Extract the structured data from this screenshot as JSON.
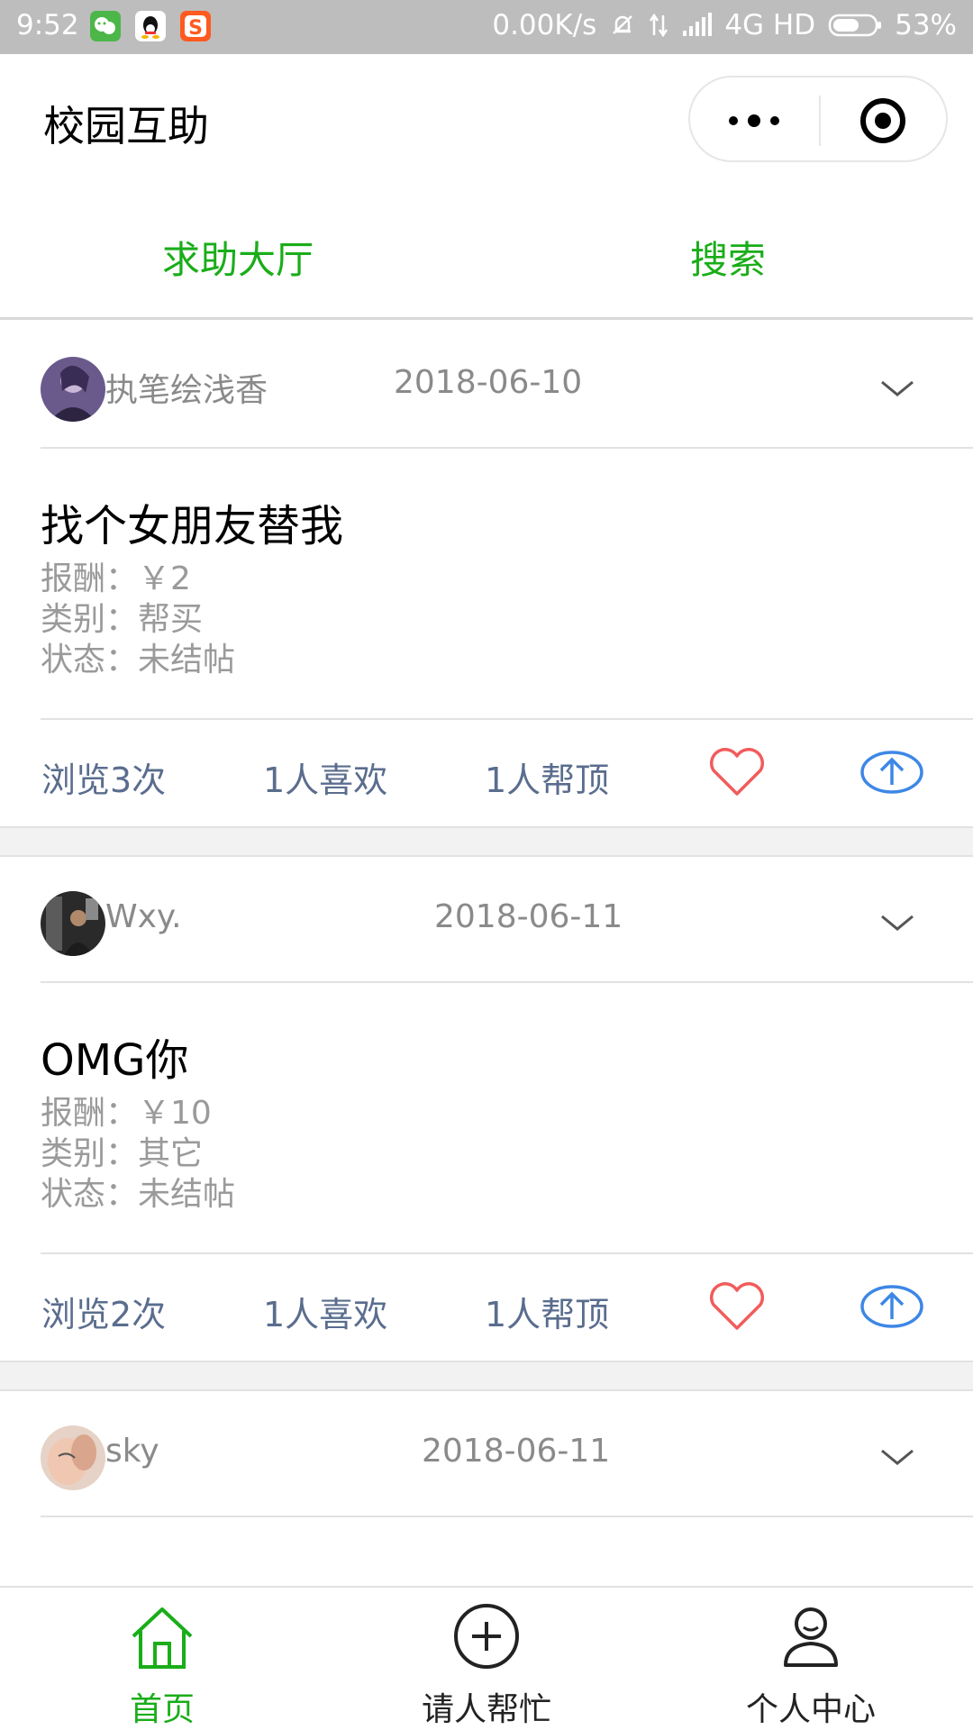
{
  "status_bar": {
    "time": "9:52",
    "speed": "0.00K/s",
    "network": "4G HD",
    "battery": "53%"
  },
  "header": {
    "title": "校园互助"
  },
  "tabs": [
    {
      "label": "求助大厅"
    },
    {
      "label": "搜索"
    }
  ],
  "colors": {
    "accent": "#1aad19",
    "stat_text": "#5a6d8e",
    "heart": "#f25b5b",
    "up_arrow": "#3d87e6"
  },
  "posts": [
    {
      "username": "执笔绘浅香",
      "date": "2018-06-10",
      "title": "找个女朋友替我",
      "reward": "报酬：￥2",
      "category": "类别：帮买",
      "status": "状态：未结帖",
      "views": "浏览3次",
      "likes": "1人喜欢",
      "tops": "1人帮顶"
    },
    {
      "username": "Wxy.",
      "date": "2018-06-11",
      "title": "OMG你",
      "reward": "报酬：￥10",
      "category": "类别：其它",
      "status": "状态：未结帖",
      "views": "浏览2次",
      "likes": "1人喜欢",
      "tops": "1人帮顶"
    },
    {
      "username": "sky",
      "date": "2018-06-11"
    }
  ],
  "bottom_nav": [
    {
      "label": "首页",
      "icon": "home-icon"
    },
    {
      "label": "请人帮忙",
      "icon": "plus-circle-icon"
    },
    {
      "label": "个人中心",
      "icon": "user-icon"
    }
  ]
}
